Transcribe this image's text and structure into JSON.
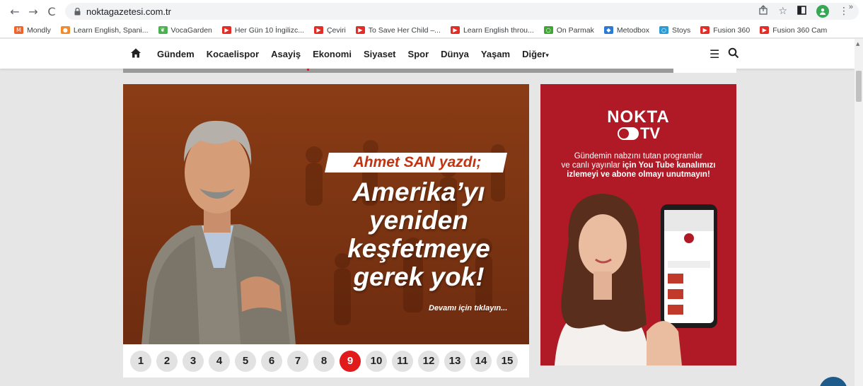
{
  "browser": {
    "url": "noktagazetesi.com.tr",
    "back_icon": "←",
    "forward_icon": "→",
    "reload_icon": "C",
    "lock_icon": "🔒",
    "share_icon": "⇪",
    "star_icon": "☆",
    "sidepanel_icon": "◧",
    "profile_icon": "👤",
    "menu_icon": "⋮"
  },
  "bookmarks": [
    {
      "label": "Mondly",
      "color": "#f0632a",
      "glyph": "M"
    },
    {
      "label": "Learn English, Spani...",
      "color": "#f28b2b",
      "glyph": "●"
    },
    {
      "label": "VocaGarden",
      "color": "#4caf50",
      "glyph": "❦"
    },
    {
      "label": "Her Gün 10 İngilizc...",
      "color": "#e52d27",
      "glyph": "▶"
    },
    {
      "label": "Çeviri",
      "color": "#e52d27",
      "glyph": "▶"
    },
    {
      "label": "To Save Her Child –...",
      "color": "#e52d27",
      "glyph": "▶"
    },
    {
      "label": "Learn English throu...",
      "color": "#e52d27",
      "glyph": "▶"
    },
    {
      "label": "On Parmak",
      "color": "#3fa535",
      "glyph": "○"
    },
    {
      "label": "Metodbox",
      "color": "#2b7bd6",
      "glyph": "◆"
    },
    {
      "label": "Stoys",
      "color": "#2b9bd6",
      "glyph": "○"
    },
    {
      "label": "Fusion 360",
      "color": "#e52d27",
      "glyph": "▶"
    },
    {
      "label": "Fusion 360 Cam",
      "color": "#e52d27",
      "glyph": "▶"
    }
  ],
  "bookmarks_more": "»",
  "site_nav": {
    "items": [
      "Gündem",
      "Kocaelispor",
      "Asayiş",
      "Ekonomi",
      "Siyaset",
      "Spor",
      "Dünya",
      "Yaşam"
    ],
    "more_label": "Diğer",
    "more_caret": "▾",
    "menu_glyph": "☰"
  },
  "slider": {
    "tag": "Ahmet SAN yazdı;",
    "headline_lines": [
      "Amerika’yı",
      "yeniden",
      "keşfetmeye",
      "gerek yok!"
    ],
    "more_link": "Devamı için tıklayın...",
    "pages": [
      "1",
      "2",
      "3",
      "4",
      "5",
      "6",
      "7",
      "8",
      "9",
      "10",
      "11",
      "12",
      "13",
      "14",
      "15"
    ],
    "active_page": "9"
  },
  "tv_ad": {
    "logo_top": "NOKTA",
    "logo_bottom": "TV",
    "line1": "Gündemin nabzını tutan programlar",
    "line2a": "ve canlı yayınlar ",
    "line2b": "için You Tube kanalımızı",
    "line3": "izlemeyi ve abone olmayı unutmayın!",
    "brand_color": "#b01a26"
  },
  "scroll": {
    "up_glyph": "▲"
  }
}
